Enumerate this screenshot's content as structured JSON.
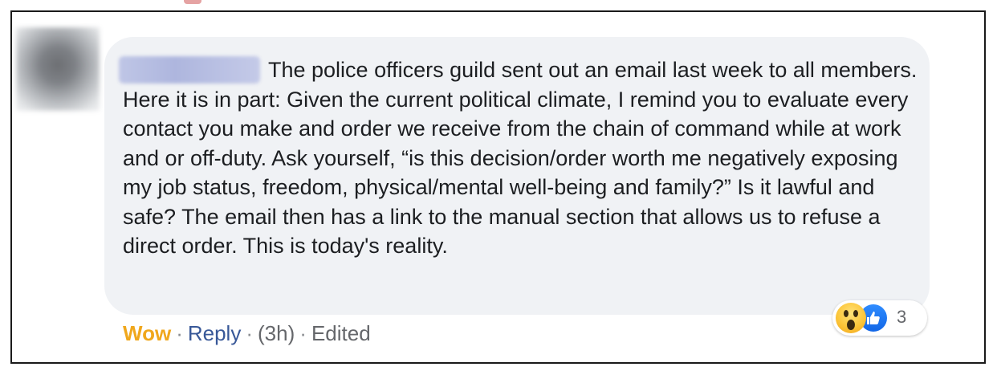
{
  "comment": {
    "author_name": "",
    "text": "The police officers guild sent out an email last week to all members. Here it is in part: Given the current political climate, I remind you to evaluate every contact you make and order we receive from the chain of command while at work and or off-duty. Ask yourself, “is this decision/order worth me negatively exposing my job status, freedom, physical/mental well-being and family?” Is it lawful and safe? The email then has a link to the manual section that allows us to refuse a direct order. This is today's reality."
  },
  "actions": {
    "wow_label": "Wow",
    "separator": "·",
    "reply_label": "Reply",
    "timestamp": "(3h)",
    "edited_label": "Edited"
  },
  "reactions": {
    "count": "3",
    "icons": [
      "wow-icon",
      "like-icon"
    ],
    "colors": {
      "wow": "#fcc63a",
      "like": "#1877f2",
      "wow_action": "#f0a71c",
      "reply_action": "#385898"
    }
  }
}
